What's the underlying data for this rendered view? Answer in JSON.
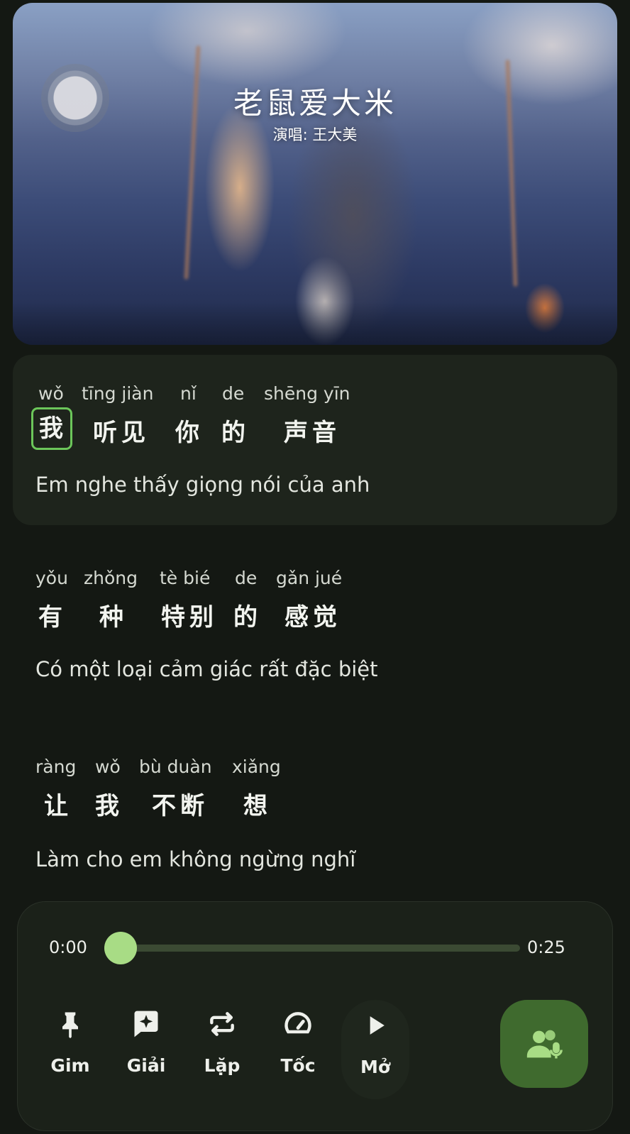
{
  "video": {
    "title": "老鼠爱大米",
    "artist": "演唱: 王大美"
  },
  "lyrics": [
    {
      "words": [
        {
          "pinyin": "wǒ",
          "hanzi": "我"
        },
        {
          "pinyin": "tīng jiàn",
          "hanzi": "听见"
        },
        {
          "pinyin": "nǐ",
          "hanzi": "你"
        },
        {
          "pinyin": "de",
          "hanzi": "的"
        },
        {
          "pinyin": "shēng yīn",
          "hanzi": "声音"
        }
      ],
      "translation": "Em nghe thấy giọng nói của anh"
    },
    {
      "words": [
        {
          "pinyin": "yǒu",
          "hanzi": "有"
        },
        {
          "pinyin": "zhǒng",
          "hanzi": "种"
        },
        {
          "pinyin": "tè bié",
          "hanzi": "特别"
        },
        {
          "pinyin": "de",
          "hanzi": "的"
        },
        {
          "pinyin": "gǎn jué",
          "hanzi": "感觉"
        }
      ],
      "translation": "Có một loại cảm giác rất đặc biệt"
    },
    {
      "words": [
        {
          "pinyin": "ràng",
          "hanzi": "让"
        },
        {
          "pinyin": "wǒ",
          "hanzi": "我"
        },
        {
          "pinyin": "bù duàn",
          "hanzi": "不断"
        },
        {
          "pinyin": "xiǎng",
          "hanzi": "想"
        }
      ],
      "translation": "Làm cho em không ngừng nghĩ"
    }
  ],
  "player": {
    "current_time": "0:00",
    "duration": "0:25",
    "progress": 0,
    "controls": [
      {
        "label": "Gim",
        "icon": "pin-icon"
      },
      {
        "label": "Giải",
        "icon": "explain-sparkle-icon"
      },
      {
        "label": "Lặp",
        "icon": "repeat-icon"
      },
      {
        "label": "Tốc",
        "icon": "speedometer-icon"
      },
      {
        "label": "Mở",
        "icon": "play-icon"
      }
    ],
    "karaoke_icon": "group-microphone-icon"
  },
  "colors": {
    "background": "#141813",
    "accent": "#a8dc85",
    "highlight_border": "#6cc65a",
    "karaoke_button": "#3f6a2e"
  }
}
